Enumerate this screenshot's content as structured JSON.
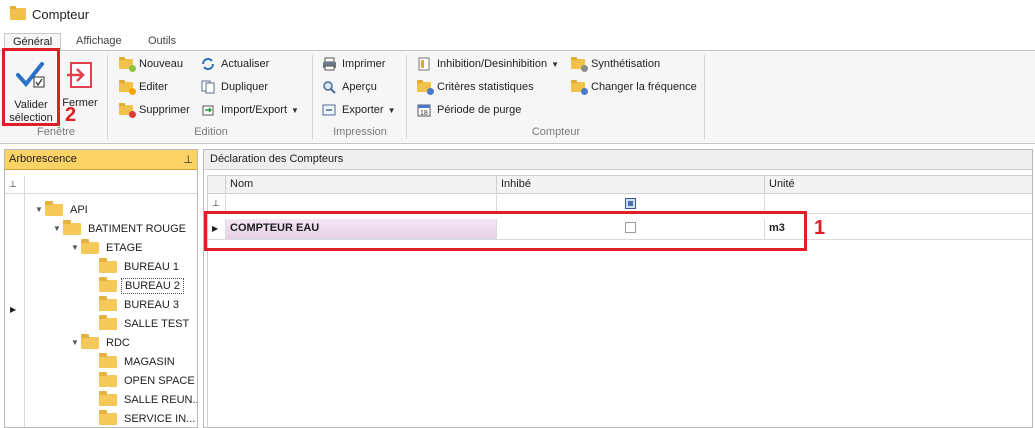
{
  "window": {
    "title": "Compteur"
  },
  "tabs": [
    {
      "label": "Général",
      "active": true
    },
    {
      "label": "Affichage",
      "active": false
    },
    {
      "label": "Outils",
      "active": false
    }
  ],
  "ribbon": {
    "fenetre": {
      "label": "Fenêtre",
      "valider_label": "Valider sélection",
      "fermer_label": "Fermer"
    },
    "edition": {
      "label": "Edition",
      "nouveau": "Nouveau",
      "editer": "Editer",
      "supprimer": "Supprimer",
      "actualiser": "Actualiser",
      "dupliquer": "Dupliquer",
      "import_export": "Import/Export"
    },
    "impression": {
      "label": "Impression",
      "imprimer": "Imprimer",
      "apercu": "Aperçu",
      "exporter": "Exporter"
    },
    "compteur": {
      "label": "Compteur",
      "inhibition": "Inhibition/Desinhibition",
      "criteres": "Critères statistiques",
      "periode": "Période de purge",
      "synthetisation": "Synthétisation",
      "changer_frequence": "Changer la fréquence"
    }
  },
  "tree": {
    "title": "Arborescence",
    "nodes": [
      {
        "label": "API",
        "level": 0,
        "expanded": true
      },
      {
        "label": "BATIMENT ROUGE",
        "level": 1,
        "expanded": true
      },
      {
        "label": "ETAGE",
        "level": 2,
        "expanded": true
      },
      {
        "label": "BUREAU 1",
        "level": 3
      },
      {
        "label": "BUREAU 2",
        "level": 3,
        "selected": true
      },
      {
        "label": "BUREAU 3",
        "level": 3
      },
      {
        "label": "SALLE TEST",
        "level": 3
      },
      {
        "label": "RDC",
        "level": 2,
        "expanded": true
      },
      {
        "label": "MAGASIN",
        "level": 3
      },
      {
        "label": "OPEN SPACE",
        "level": 3
      },
      {
        "label": "SALLE REUN...",
        "level": 3
      },
      {
        "label": "SERVICE IN...",
        "level": 3
      }
    ]
  },
  "grid": {
    "title": "Déclaration des Compteurs",
    "columns": [
      "Nom",
      "Inhibé",
      "Unité"
    ],
    "rows": [
      {
        "nom": "COMPTEUR EAU",
        "inhibe": false,
        "unite": "m3"
      }
    ]
  },
  "annotations": {
    "marker1": "1",
    "marker2": "2"
  },
  "colors": {
    "annotation": "#e01e25",
    "tree_header": "#fbd266",
    "selected_row": "#e8d4ea"
  }
}
